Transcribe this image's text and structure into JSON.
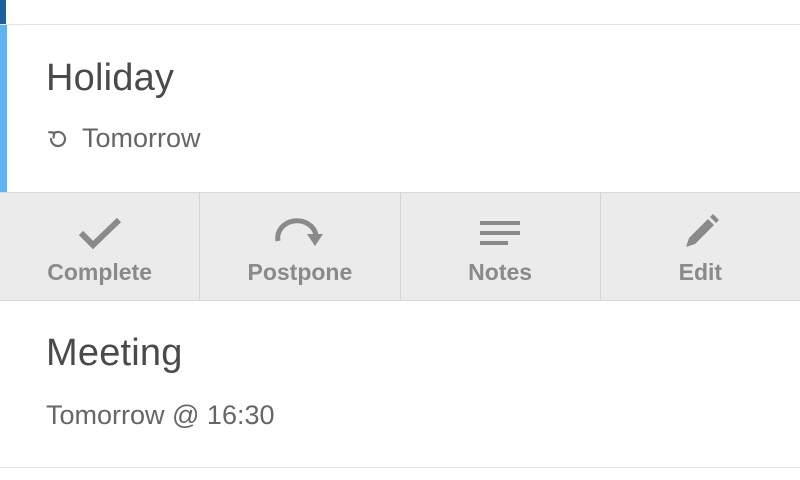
{
  "tasks": [
    {
      "title": "Holiday",
      "due": "Tomorrow",
      "icon": "repeat-icon",
      "accent_color": "#5fb4f0"
    },
    {
      "title": "Meeting",
      "due": "Tomorrow @ 16:30"
    }
  ],
  "actions": [
    {
      "label": "Complete",
      "icon": "check-icon"
    },
    {
      "label": "Postpone",
      "icon": "postpone-arrow-icon"
    },
    {
      "label": "Notes",
      "icon": "notes-icon"
    },
    {
      "label": "Edit",
      "icon": "pencil-icon"
    }
  ],
  "colors": {
    "previous_item_accent": "#1e5f99",
    "selected_accent": "#5fb4f0",
    "action_bar_bg": "#ebebeb",
    "action_text": "#8a8a8a"
  }
}
